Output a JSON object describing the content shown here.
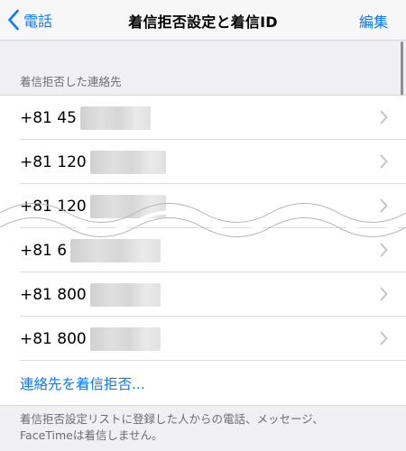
{
  "nav": {
    "back_label": "電話",
    "title": "着信拒否設定と着信ID",
    "edit_label": "編集"
  },
  "section": {
    "header": "着信拒否した連絡先"
  },
  "blocked": [
    {
      "number": "+81 45"
    },
    {
      "number": "+81 120"
    },
    {
      "number": "+81 120"
    },
    {
      "number": "+81 6"
    },
    {
      "number": "+81 800"
    },
    {
      "number": "+81 800"
    }
  ],
  "add_contact_label": "連絡先を着信拒否...",
  "footer": {
    "line1": "着信拒否設定リストに登録した人からの電話、メッセージ、",
    "line2": "FaceTimeは着信しません。"
  },
  "colors": {
    "accent": "#0a7aff",
    "background": "#efeff4"
  }
}
